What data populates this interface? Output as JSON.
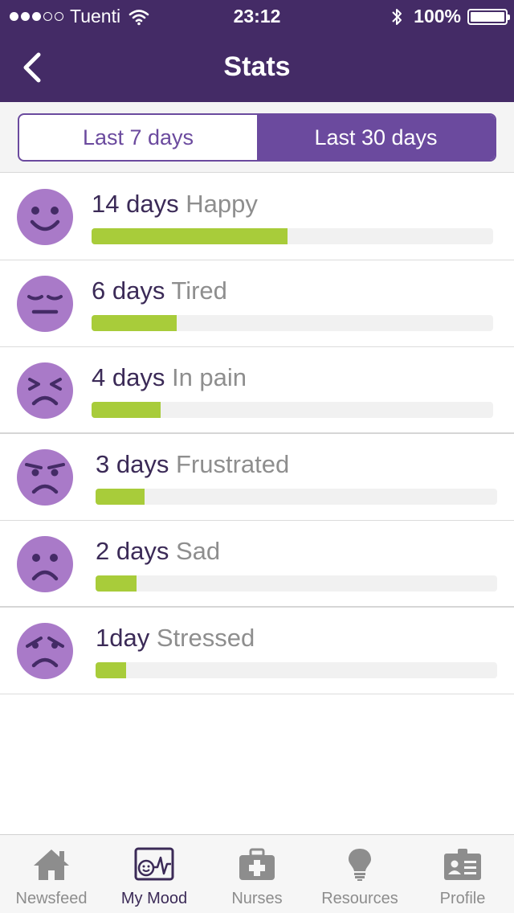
{
  "status_bar": {
    "carrier": "Tuenti",
    "time": "23:12",
    "battery": "100%",
    "signal_icon": "signal-dots-icon",
    "wifi_icon": "wifi-icon",
    "bluetooth_icon": "bluetooth-icon",
    "battery_icon": "battery-icon"
  },
  "nav": {
    "title": "Stats",
    "back_icon": "chevron-left-icon"
  },
  "segments": [
    {
      "label": "Last 7 days",
      "selected": false
    },
    {
      "label": "Last 30 days",
      "selected": true
    }
  ],
  "moods": [
    {
      "count": "14 days",
      "label": "Happy",
      "fraction": 0.487,
      "icon": "happy-face-icon"
    },
    {
      "count": "6 days",
      "label": "Tired",
      "fraction": 0.212,
      "icon": "tired-face-icon"
    },
    {
      "count": "4 days",
      "label": "In pain",
      "fraction": 0.172,
      "icon": "pain-face-icon"
    },
    {
      "count": "3 days",
      "label": "Frustrated",
      "fraction": 0.122,
      "icon": "frustrated-face-icon"
    },
    {
      "count": "2 days",
      "label": "Sad",
      "fraction": 0.102,
      "icon": "sad-face-icon"
    },
    {
      "count": "1day",
      "label": "Stressed",
      "fraction": 0.075,
      "icon": "stressed-face-icon"
    }
  ],
  "tabs": [
    {
      "label": "Newsfeed",
      "icon": "home-icon",
      "active": false
    },
    {
      "label": "My Mood",
      "icon": "mood-chart-icon",
      "active": true
    },
    {
      "label": "Nurses",
      "icon": "medical-kit-icon",
      "active": false
    },
    {
      "label": "Resources",
      "icon": "lightbulb-icon",
      "active": false
    },
    {
      "label": "Profile",
      "icon": "id-card-icon",
      "active": false
    }
  ],
  "colors": {
    "header": "#442b66",
    "accent": "#6b4a9e",
    "face": "#a97ac8",
    "bar": "#a8cc3a"
  }
}
